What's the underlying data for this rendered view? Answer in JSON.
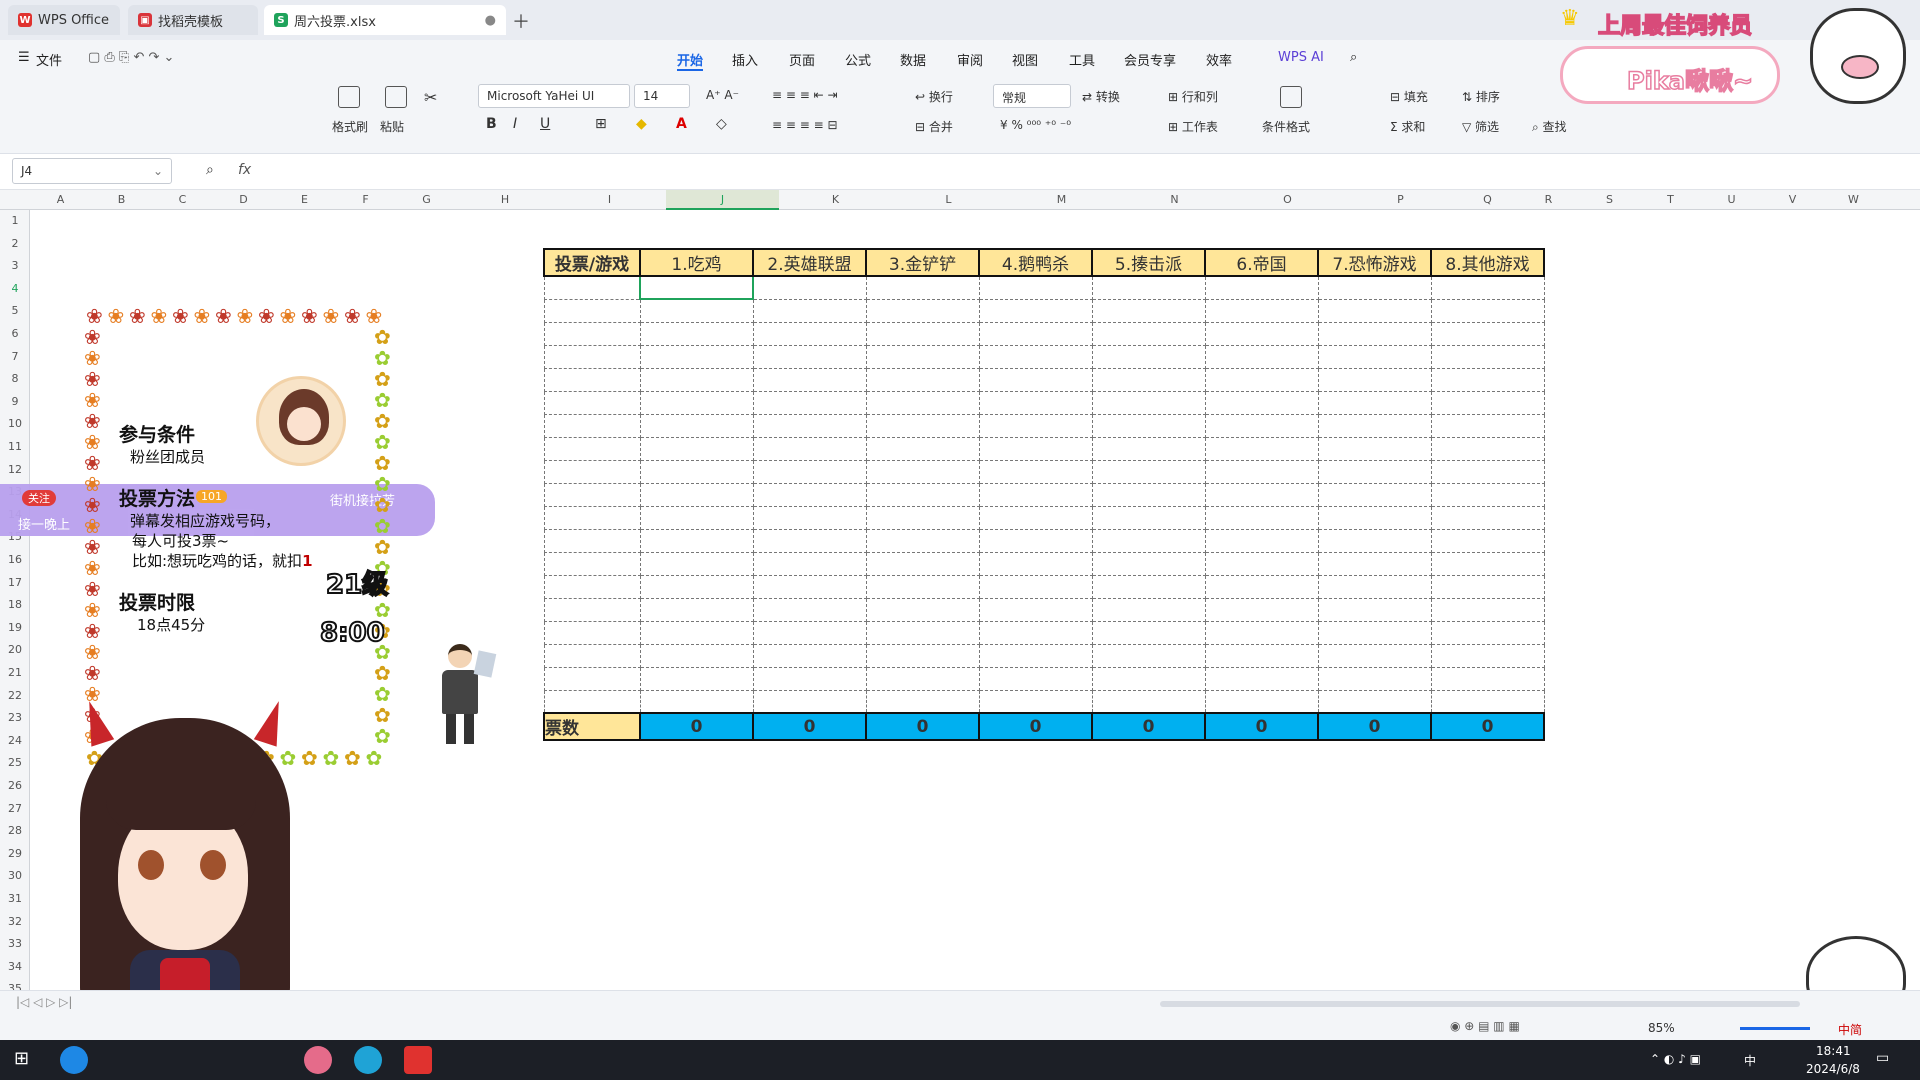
{
  "tabs": [
    {
      "label": "WPS Office"
    },
    {
      "label": "找稻壳模板"
    },
    {
      "label": "周六投票.xlsx"
    }
  ],
  "menu": {
    "file": "文件",
    "items": [
      "开始",
      "插入",
      "页面",
      "公式",
      "数据",
      "审阅",
      "视图",
      "工具",
      "会员专享",
      "效率"
    ],
    "wps_ai": "WPS AI"
  },
  "ribbon": {
    "format_painter": "格式刷",
    "paste": "粘贴",
    "font": "Microsoft YaHei UI",
    "size": "14",
    "wrap": "换行",
    "merge": "合并",
    "number_format": "常规",
    "convert": "转换",
    "rowcol": "行和列",
    "worksheet": "工作表",
    "cond_format": "条件格式",
    "fill": "填充",
    "sort": "排序",
    "sum": "求和",
    "filter": "筛选",
    "find": "查找"
  },
  "namebox": "J4",
  "fx": "fx",
  "columns": [
    "A",
    "B",
    "C",
    "D",
    "E",
    "F",
    "G",
    "H",
    "I",
    "J",
    "K",
    "L",
    "M",
    "N",
    "O",
    "P",
    "Q",
    "R",
    "S",
    "T",
    "U",
    "V",
    "W"
  ],
  "rows": [
    "1",
    "2",
    "3",
    "4",
    "5",
    "6",
    "7",
    "8",
    "9",
    "10",
    "11",
    "12",
    "13",
    "14",
    "15",
    "16",
    "17",
    "18",
    "19",
    "20",
    "21",
    "22",
    "23",
    "24",
    "25",
    "26",
    "27",
    "28",
    "29",
    "30",
    "31",
    "32",
    "33",
    "34",
    "35"
  ],
  "vote_table": {
    "headers": [
      "投票/游戏",
      "1.吃鸡",
      "2.英雄联盟",
      "3.金铲铲",
      "4.鹅鸭杀",
      "5.揍击派",
      "6.帝国",
      "7.恐怖游戏",
      "8.其他游戏"
    ],
    "total_label": "票数",
    "totals": [
      "0",
      "0",
      "0",
      "0",
      "0",
      "0",
      "0",
      "0"
    ]
  },
  "panel": {
    "cond_title": "参与条件",
    "cond_text": "粉丝团成员",
    "method_title": "投票方法",
    "method_1": "弹幕发相应游戏号码，",
    "method_2": "每人可投3票~",
    "method_3": "比如:想玩吃鸡的话，就扣",
    "method_num": "1",
    "time_title": "投票时限",
    "time_text": "18点45分",
    "level": "21级",
    "clock": "8:00"
  },
  "danmu": {
    "tag": "关注",
    "badge": "101",
    "text1": "街机接拉芳",
    "text2": "接一晚上"
  },
  "overlay": {
    "banner": "上周最佳饲养员",
    "name": "Pika啾啾~"
  },
  "status": {
    "zoom": "85%",
    "ime": "中简"
  },
  "taskbar": {
    "time": "18:41",
    "date": "2024/6/8",
    "ime": "中"
  },
  "colors": {
    "header_fill": "#ffe699",
    "total_fill": "#00b0f0",
    "accent": "#c00000"
  }
}
